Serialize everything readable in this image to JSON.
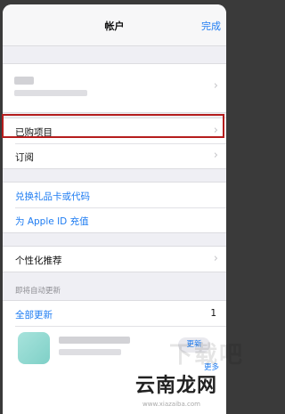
{
  "navbar": {
    "title": "帐户",
    "done_label": "完成"
  },
  "menu": {
    "purchased": "已购项目",
    "subscriptions": "订阅",
    "redeem": "兑换礼品卡或代码",
    "add_funds": "为 Apple ID 充值",
    "personalized": "个性化推荐"
  },
  "updates": {
    "section_header": "即将自动更新",
    "update_all": "全部更新",
    "count": "1",
    "update_button": "更新",
    "more": "更多"
  },
  "watermark": {
    "text": "云南龙网",
    "url": "www.xiazaiba.com",
    "ghost": "下载吧"
  },
  "colors": {
    "accent": "#1e7cf2",
    "highlight_border": "#b51d1d"
  },
  "icons": {
    "chevron": "›"
  }
}
